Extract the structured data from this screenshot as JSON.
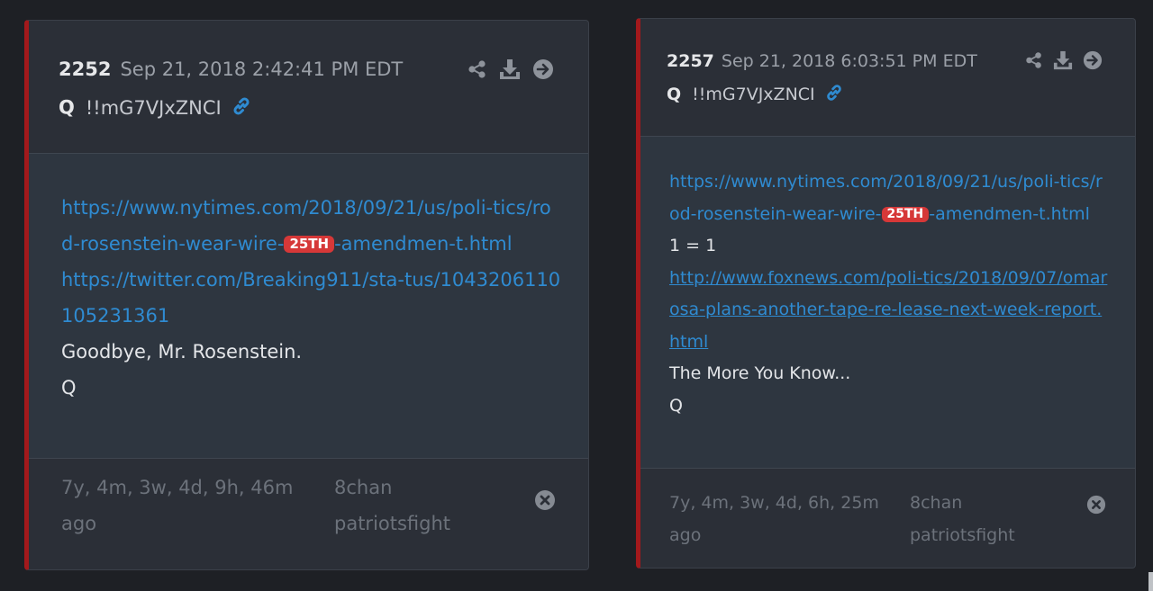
{
  "posts": [
    {
      "number": "2252",
      "date": "Sep 21, 2018 2:42:41 PM EDT",
      "author": "Q",
      "tripcode": "!!mG7VJxZNCI",
      "link1_pre": "https://www.nytimes.com/2018/09/21/us/poli-tics/rod-rosenstein-wear-wire-",
      "badge": "25TH",
      "link1_post": "-amendmen-t.html",
      "link2": "https://twitter.com/Breaking911/sta-tus/1043206110105231361",
      "text1": "Goodbye, Mr. Rosenstein.",
      "signature": "Q",
      "age": "7y, 4m, 3w, 4d, 9h, 46m ago",
      "source_board": "8chan",
      "source_name": "patriotsfight"
    },
    {
      "number": "2257",
      "date": "Sep 21, 2018 6:03:51 PM EDT",
      "author": "Q",
      "tripcode": "!!mG7VJxZNCI",
      "link1_pre": "https://www.nytimes.com/2018/09/21/us/poli-tics/rod-rosenstein-wear-wire-",
      "badge": "25TH",
      "link1_post": "-amendmen-t.html",
      "text_eq": "1 = 1",
      "link2": "http://www.foxnews.com/poli-tics/2018/09/07/omarosa-plans-another-tape-re-lease-next-week-report.html",
      "text1": "The More You Know...",
      "signature": "Q",
      "age": "7y, 4m, 3w, 4d, 6h, 25m ago",
      "source_board": "8chan",
      "source_name": "patriotsfight"
    }
  ],
  "icons": [
    "share-icon",
    "download-icon",
    "arrow-right-circle-icon",
    "link-icon",
    "close-circle-icon"
  ],
  "colors": {
    "accent_border": "#a3191c",
    "link": "#2f8bd1",
    "badge": "#d63838"
  }
}
